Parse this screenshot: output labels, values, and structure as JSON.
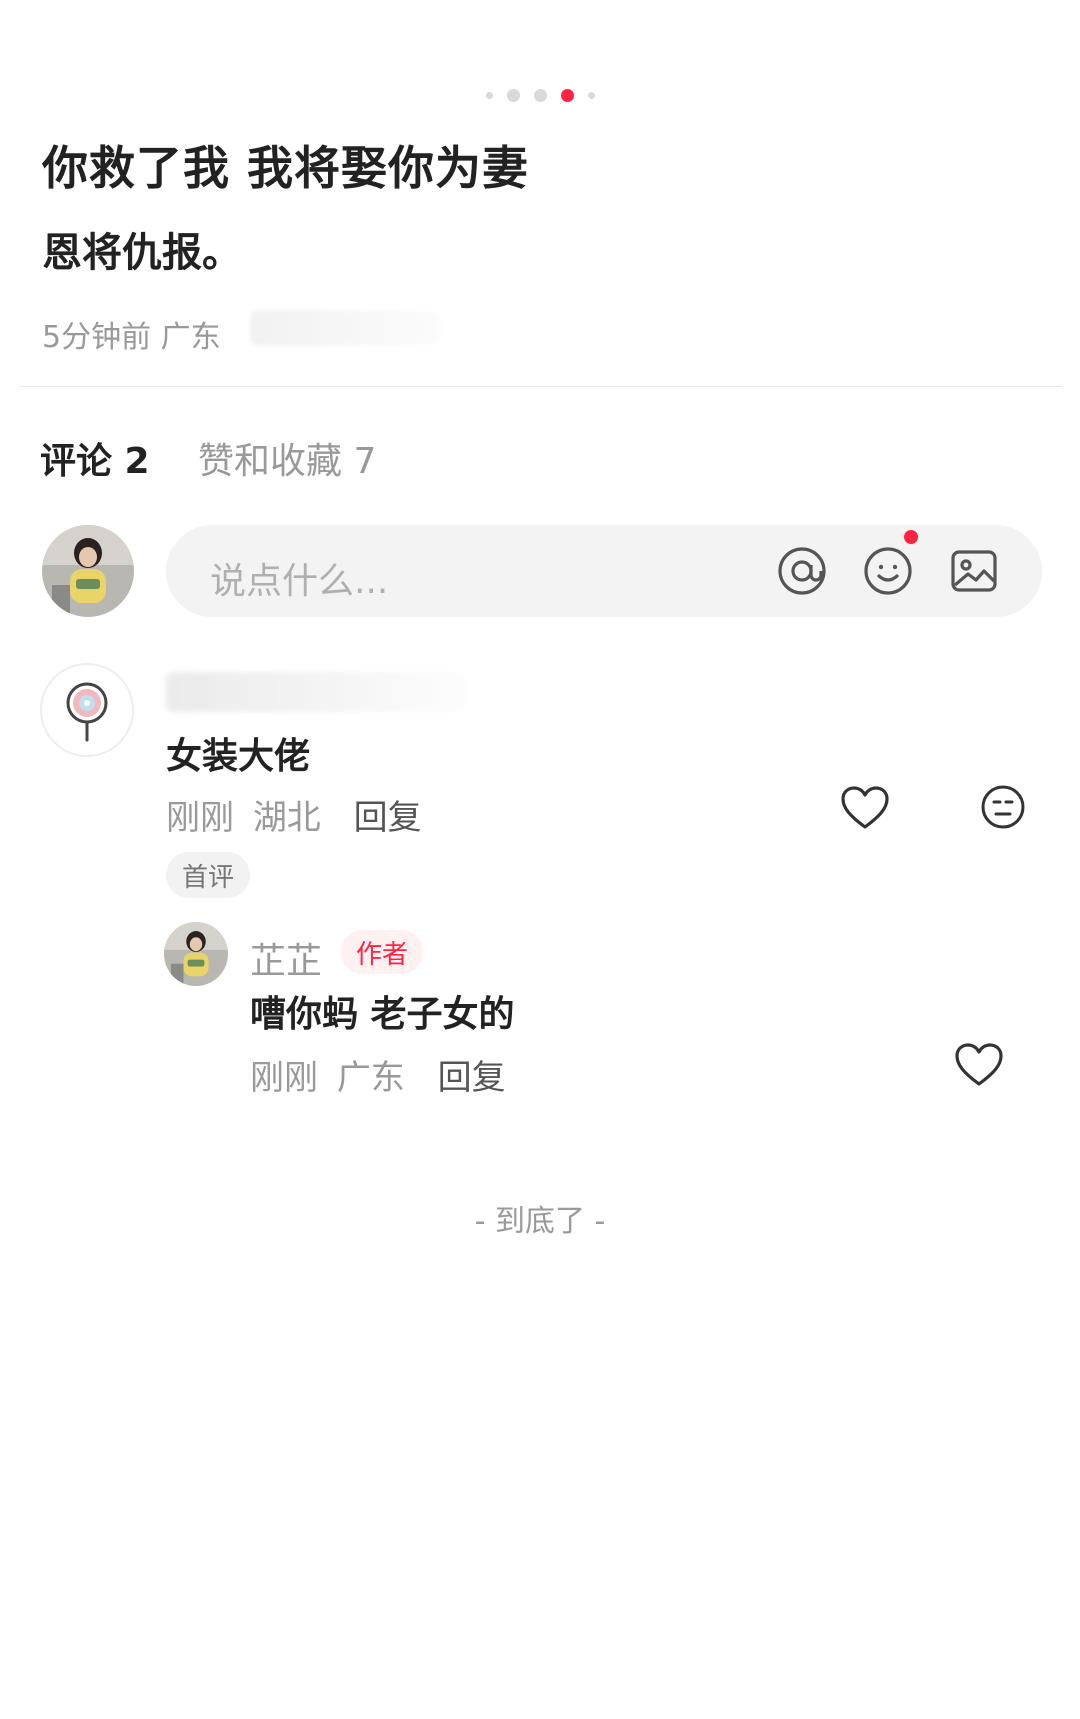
{
  "post": {
    "title": "你救了我 我将娶你为妻",
    "body": "恩将仇报。",
    "meta": "5分钟前 广东"
  },
  "pager": {
    "total": 5,
    "active_index": 3
  },
  "tabs": {
    "comments_label": "评论 2",
    "likes_label": "赞和收藏 7"
  },
  "input": {
    "placeholder": "说点什么..."
  },
  "icons": {
    "mention": "at-icon",
    "emoji": "emoji-icon",
    "image": "image-icon",
    "like": "heart-icon",
    "dislike": "dislike-face-icon"
  },
  "colors": {
    "accent": "#ff2442",
    "muted": "#999999"
  },
  "comments": [
    {
      "text": "女装大佬",
      "time": "刚刚",
      "location": "湖北",
      "reply_label": "回复",
      "badge": "首评",
      "replies": [
        {
          "author": "芷芷",
          "author_badge": "作者",
          "text": "嘈你蚂 老子女的",
          "time": "刚刚",
          "location": "广东",
          "reply_label": "回复"
        }
      ]
    }
  ],
  "footer": {
    "end_label": "- 到底了 -"
  }
}
